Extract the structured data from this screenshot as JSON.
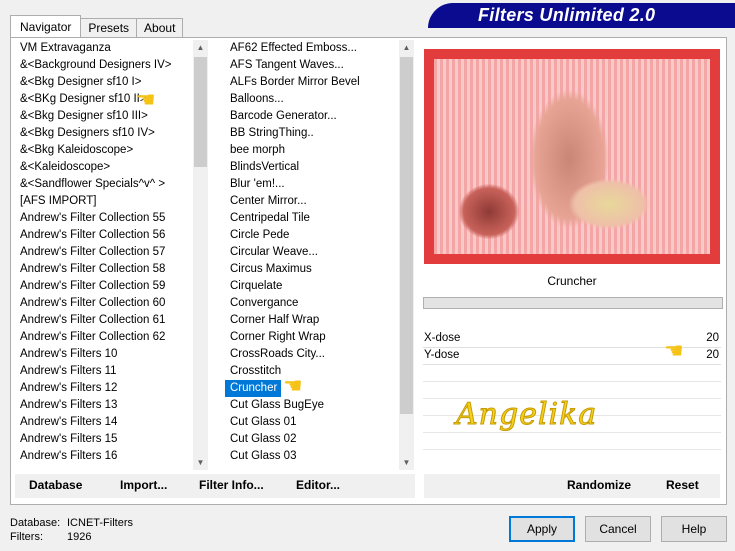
{
  "app_title": "Filters Unlimited 2.0",
  "tabs": [
    "Navigator",
    "Presets",
    "About"
  ],
  "categories": [
    "VM Extravaganza",
    "&<Background Designers IV>",
    "&<Bkg Designer sf10 I>",
    "&<BKg Designer sf10 II>",
    "&<Bkg Designer sf10 III>",
    "&<Bkg Designers sf10 IV>",
    "&<Bkg Kaleidoscope>",
    "&<Kaleidoscope>",
    "&<Sandflower Specials^v^ >",
    "[AFS IMPORT]",
    "Andrew's Filter Collection 55",
    "Andrew's Filter Collection 56",
    "Andrew's Filter Collection 57",
    "Andrew's Filter Collection 58",
    "Andrew's Filter Collection 59",
    "Andrew's Filter Collection 60",
    "Andrew's Filter Collection 61",
    "Andrew's Filter Collection 62",
    "Andrew's Filters 10",
    "Andrew's Filters 11",
    "Andrew's Filters 12",
    "Andrew's Filters 13",
    "Andrew's Filters 14",
    "Andrew's Filters 15",
    "Andrew's Filters 16"
  ],
  "filters": [
    "AF62 Effected Emboss...",
    "AFS Tangent Waves...",
    "ALFs Border Mirror Bevel",
    "Balloons...",
    "Barcode Generator...",
    "BB StringThing..",
    "bee morph",
    "BlindsVertical",
    "Blur 'em!...",
    "Center Mirror...",
    "Centripedal Tile",
    "Circle Pede",
    "Circular Weave...",
    "Circus Maximus",
    "Cirquelate",
    "Convergance",
    "Corner Half Wrap",
    "Corner Right Wrap",
    "CrossRoads City...",
    "Crosstitch",
    "Cruncher",
    "Cut Glass  BugEye",
    "Cut Glass 01",
    "Cut Glass 02",
    "Cut Glass 03"
  ],
  "selected_filter": "Cruncher",
  "params": [
    {
      "label": "X-dose",
      "value": "20"
    },
    {
      "label": "Y-dose",
      "value": "20"
    }
  ],
  "watermark": "Angelika",
  "buttons_left": {
    "database": "Database",
    "import": "Import...",
    "filter_info": "Filter Info...",
    "editor": "Editor..."
  },
  "buttons_right": {
    "randomize": "Randomize",
    "reset": "Reset"
  },
  "status": {
    "database_label": "Database:",
    "database_value": "ICNET-Filters",
    "filters_label": "Filters:",
    "filters_value": "1926"
  },
  "dialog_buttons": {
    "apply": "Apply",
    "cancel": "Cancel",
    "help": "Help"
  },
  "colors": {
    "banner": "#0b0b8f",
    "selection": "#0078d7",
    "preview": "#e23c3c",
    "watermark": "#f5d21a"
  }
}
